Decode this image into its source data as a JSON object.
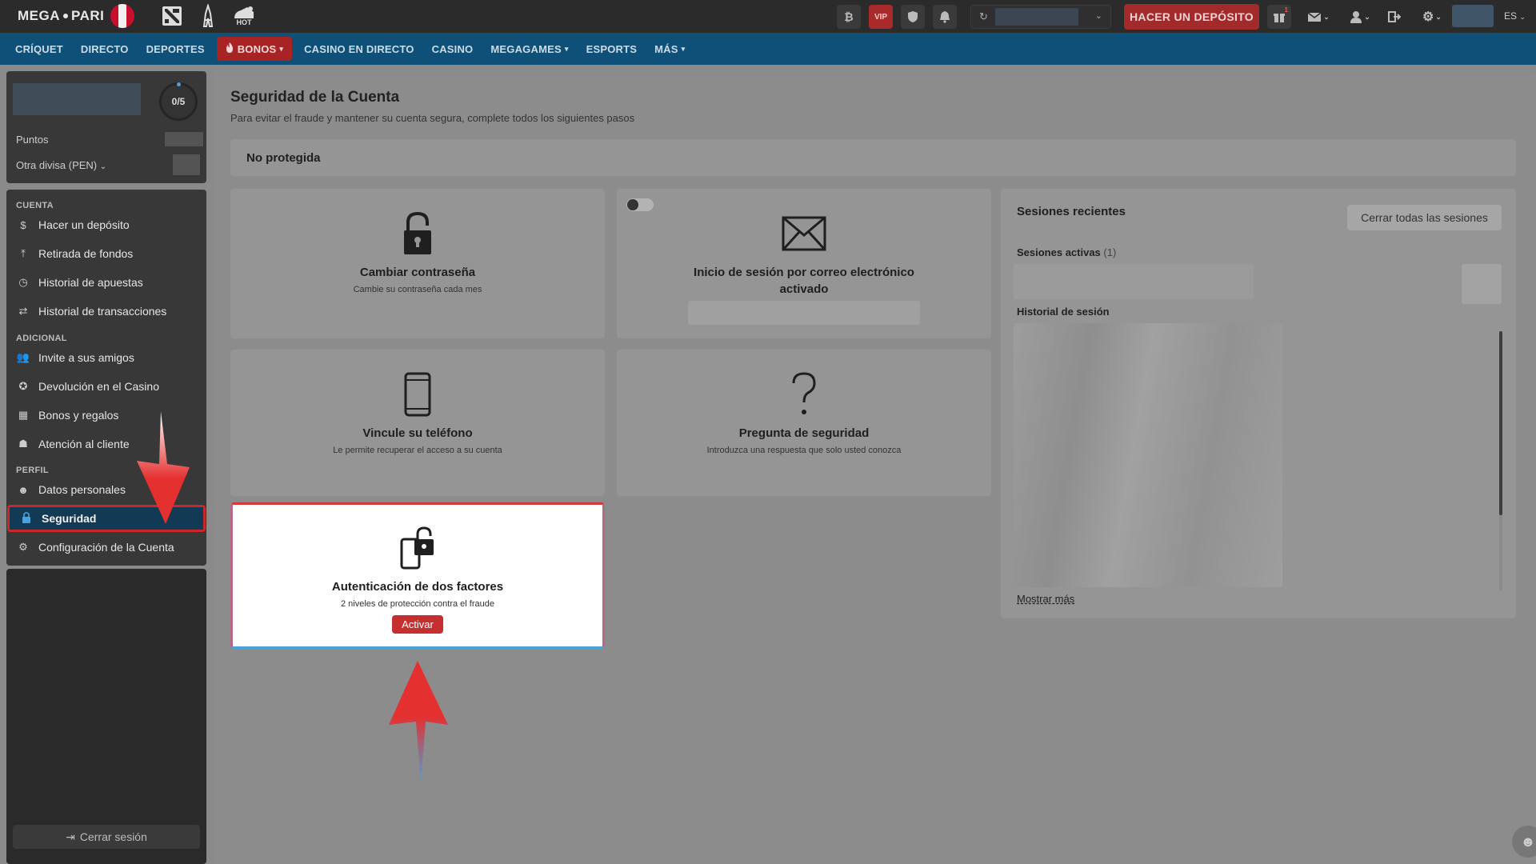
{
  "header": {
    "logo_left": "MEGA",
    "logo_right": "PARI",
    "hot_label": "HOT",
    "vip_label": "VIP",
    "bitcoin_symbol": "₿",
    "deposit_label": "HACER UN DEPÓSITO",
    "gift_badge": "1",
    "language": "ES"
  },
  "nav": [
    {
      "label": "CRÍQUET"
    },
    {
      "label": "DIRECTO"
    },
    {
      "label": "DEPORTES"
    },
    {
      "label": "BONOS",
      "active": true,
      "dropdown": true
    },
    {
      "label": "CASINO EN DIRECTO"
    },
    {
      "label": "CASINO"
    },
    {
      "label": "MEGAGAMES",
      "dropdown": true
    },
    {
      "label": "ESPORTS"
    },
    {
      "label": "MÁS",
      "dropdown": true
    }
  ],
  "sidebar": {
    "progress": "0/5",
    "points_label": "Puntos",
    "currency_label": "Otra divisa (PEN)",
    "section_account": "CUENTA",
    "section_extra": "ADICIONAL",
    "section_profile": "PERFIL",
    "items": [
      {
        "label": "Hacer un depósito",
        "icon": "dollar-icon"
      },
      {
        "label": "Retirada de fondos",
        "icon": "upload-icon"
      },
      {
        "label": "Historial de apuestas",
        "icon": "clock-icon"
      },
      {
        "label": "Historial de transacciones",
        "icon": "transfer-icon"
      },
      {
        "label": "Invite a sus amigos",
        "icon": "users-icon"
      },
      {
        "label": "Devolución en el Casino",
        "icon": "chip-icon"
      },
      {
        "label": "Bonos y regalos",
        "icon": "gift-icon"
      },
      {
        "label": "Atención al cliente",
        "icon": "support-icon"
      },
      {
        "label": "Datos personales",
        "icon": "person-icon"
      },
      {
        "label": "Seguridad",
        "icon": "lock-icon",
        "active": true
      },
      {
        "label": "Configuración de la Cuenta",
        "icon": "gear-icon"
      }
    ],
    "logout_label": "Cerrar sesión"
  },
  "main": {
    "title": "Seguridad de la Cuenta",
    "subtitle": "Para evitar el fraude y mantener su cuenta segura, complete todos los siguientes pasos",
    "status": "No protegida",
    "cards": {
      "password": {
        "title": "Cambiar contraseña",
        "sub": "Cambie su contraseña cada mes"
      },
      "email": {
        "title": "Inicio de sesión por correo electrónico activado"
      },
      "phone": {
        "title": "Vincule su teléfono",
        "sub": "Le permite recuperar el acceso a su cuenta"
      },
      "question": {
        "title": "Pregunta de seguridad",
        "sub": "Introduzca una respuesta que solo usted conozca"
      },
      "twofa": {
        "title": "Autenticación de dos factores",
        "sub": "2 niveles de protección contra el fraude",
        "button": "Activar"
      }
    },
    "sessions": {
      "title": "Sesiones recientes",
      "close_all": "Cerrar todas las sesiones",
      "active_label": "Sesiones activas",
      "active_count": "(1)",
      "history_label": "Historial de sesión",
      "show_more": "Mostrar más"
    }
  },
  "colors": {
    "topbar": "#2b2b2b",
    "navbar": "#0f5078",
    "accent_red": "#c62f2f",
    "highlight_blue": "#4aa3d8"
  }
}
